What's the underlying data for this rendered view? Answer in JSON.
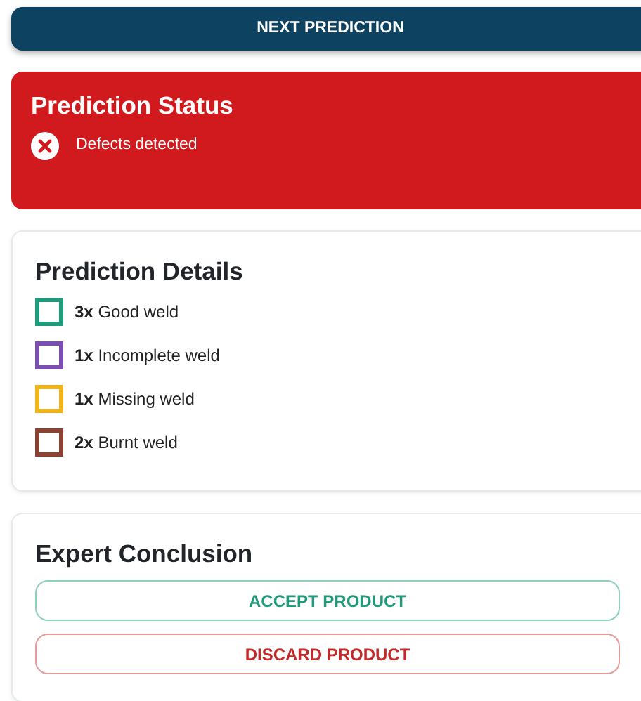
{
  "next_button": {
    "label": "NEXT PREDICTION"
  },
  "status": {
    "title": "Prediction Status",
    "kind": "error",
    "message": "Defects detected"
  },
  "details": {
    "title": "Prediction Details",
    "items": [
      {
        "text": "**3x** Good weld",
        "color": "#1f9a7a"
      },
      {
        "text": "**1x** Incomplete weld",
        "color": "#7b4fb0"
      },
      {
        "text": "**1x** Missing weld",
        "color": "#f0b51c"
      },
      {
        "text": "**2x** Burnt weld",
        "color": "#8a4232"
      }
    ]
  },
  "conclusion": {
    "title": "Expert Conclusion",
    "buttons": [
      {
        "label": "ACCEPT PRODUCT",
        "kind": "accept"
      },
      {
        "label": "DISCARD PRODUCT",
        "kind": "discard"
      }
    ]
  }
}
